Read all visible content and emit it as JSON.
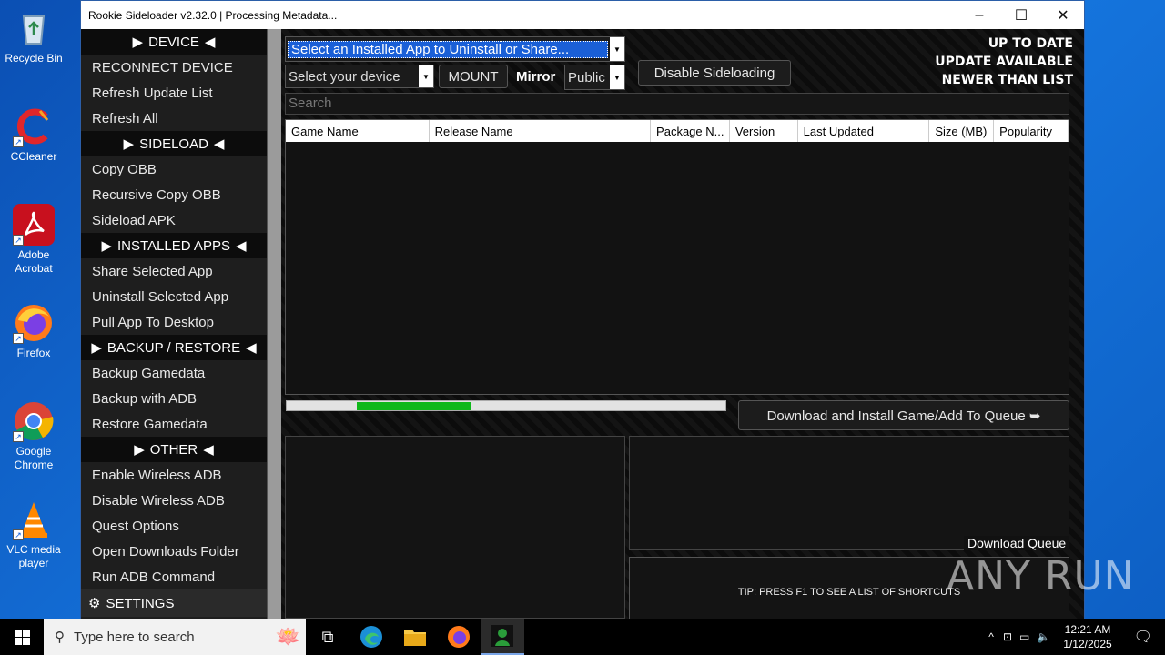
{
  "desktop": {
    "icons": [
      {
        "label": "Recycle Bin",
        "icon": "recycle-bin-icon"
      },
      {
        "label": "CCleaner",
        "icon": "ccleaner-icon"
      },
      {
        "label": "Adobe Acrobat",
        "icon": "adobe-acrobat-icon"
      },
      {
        "label": "Firefox",
        "icon": "firefox-icon"
      },
      {
        "label": "Google Chrome",
        "icon": "chrome-icon"
      },
      {
        "label": "VLC media player",
        "icon": "vlc-icon"
      }
    ]
  },
  "window": {
    "title": "Rookie Sideloader v2.32.0 | Processing Metadata...",
    "minimize": "–",
    "maximize": "☐",
    "close": "✕"
  },
  "sidebar": {
    "sections": [
      {
        "header": "DEVICE",
        "items": [
          "RECONNECT DEVICE",
          "Refresh Update List",
          "Refresh All"
        ]
      },
      {
        "header": "SIDELOAD",
        "items": [
          "Copy OBB",
          "Recursive Copy OBB",
          "Sideload APK"
        ]
      },
      {
        "header": "INSTALLED APPS",
        "items": [
          "Share Selected App",
          "Uninstall Selected App",
          "Pull App To Desktop"
        ]
      },
      {
        "header": "BACKUP / RESTORE",
        "items": [
          "Backup Gamedata",
          "Backup with ADB",
          "Restore Gamedata"
        ]
      },
      {
        "header": "OTHER",
        "items": [
          "Enable Wireless ADB",
          "Disable Wireless ADB",
          "Quest Options",
          "Open Downloads Folder",
          "Run ADB Command"
        ]
      }
    ],
    "settings": "SETTINGS"
  },
  "controls": {
    "installed_app_select": "Select an Installed App to Uninstall or Share...",
    "device_select": "Select your device",
    "mount": "MOUNT",
    "mirror_label": "Mirror",
    "mirror_value": "Public",
    "disable_sideloading": "Disable Sideloading",
    "search_placeholder": "Search",
    "download_button": "Download  and  Install  Game/Add  To  Queue  ➥"
  },
  "status": {
    "line1": "UP TO DATE",
    "line2": "UPDATE AVAILABLE",
    "line3": "NEWER THAN LIST"
  },
  "table": {
    "columns": [
      "Game Name",
      "Release Name",
      "Package N...",
      "Version",
      "Last Updated",
      "Size (MB)",
      "Popularity"
    ],
    "rows": []
  },
  "progress": {
    "fraction_start": 0.16,
    "fraction_width": 0.26
  },
  "queue": {
    "label": "Download Queue",
    "tip": "TIP: PRESS F1 TO SEE A LIST OF SHORTCUTS"
  },
  "watermark": "ANY RUN",
  "taskbar": {
    "search_placeholder": "Type here to search",
    "time": "12:21 AM",
    "date": "1/12/2025"
  },
  "colors": {
    "desktop": "#1677e0",
    "progress_fill": "#0fb81a",
    "selection": "#1a5fd6"
  }
}
